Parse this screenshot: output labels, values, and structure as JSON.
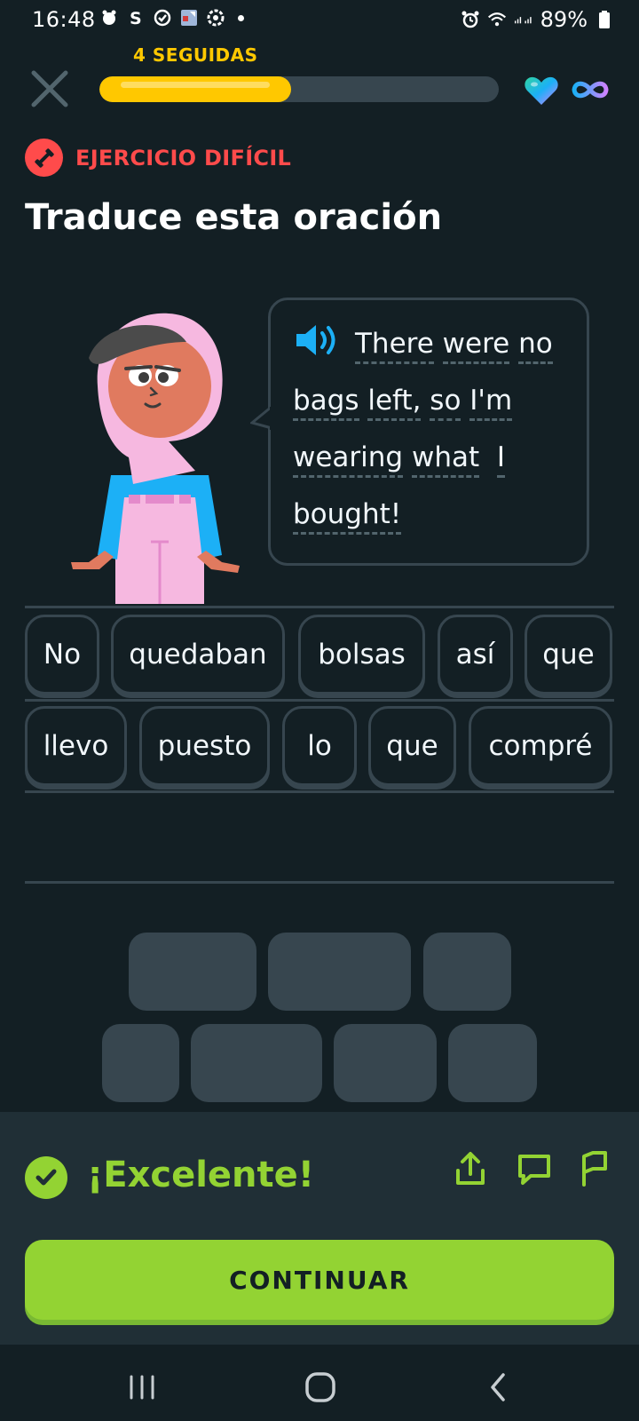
{
  "status_bar": {
    "time": "16:48",
    "battery": "89%"
  },
  "top_bar": {
    "streak_label": "4 SEGUIDAS",
    "progress": 0.48,
    "hearts": "infinite"
  },
  "badge": {
    "label": "EJERCICIO DIFÍCIL"
  },
  "heading": "Traduce esta oración",
  "prompt": {
    "words": [
      "There",
      "were",
      "no",
      "bags",
      "left,",
      "so",
      "I'm",
      "wearing",
      "what",
      "I",
      "bought!"
    ]
  },
  "answer_chips": {
    "row1": [
      "No",
      "quedaban",
      "bolsas",
      "así",
      "que"
    ],
    "row2": [
      "llevo",
      "puesto",
      "lo",
      "que",
      "compré"
    ]
  },
  "feedback": {
    "title": "¡Excelente!",
    "continue_label": "CONTINUAR"
  },
  "colors": {
    "background": "#131F24",
    "green": "#93D333",
    "streak_yellow": "#FFC800",
    "badge_red": "#FF4B4B"
  },
  "icons": [
    "close-icon",
    "heart-icon",
    "infinity-icon",
    "dumbbell-icon",
    "speaker-icon",
    "check-icon",
    "share-icon",
    "comment-icon",
    "flag-icon"
  ]
}
